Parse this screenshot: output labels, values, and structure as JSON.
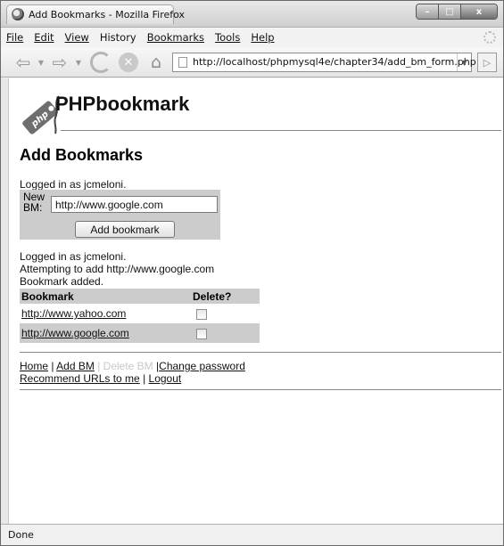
{
  "window": {
    "title": "Add Bookmarks - Mozilla Firefox",
    "minimize": "–",
    "maximize": "□",
    "close": "x"
  },
  "menubar": {
    "file": "File",
    "edit": "Edit",
    "view": "View",
    "history": "History",
    "bookmarks": "Bookmarks",
    "tools": "Tools",
    "help": "Help"
  },
  "navbar": {
    "url": "http://localhost/phpmysql4e/chapter34/add_bm_form.php"
  },
  "page": {
    "brand": "PHPbookmark",
    "logo_badge": "php",
    "title": "Add Bookmarks",
    "logged_in_top": "Logged in as jcmeloni.",
    "form": {
      "label": "New BM:",
      "value": "http://www.google.com",
      "button": "Add bookmark"
    },
    "logged_in_msg": "Logged in as jcmeloni.",
    "attempt_msg": "Attempting to add http://www.google.com",
    "added_msg": "Bookmark added.",
    "table": {
      "headers": [
        "Bookmark",
        "Delete?"
      ],
      "rows": [
        {
          "url": "http://www.yahoo.com",
          "checked": false
        },
        {
          "url": "http://www.google.com",
          "checked": false
        }
      ]
    },
    "links": {
      "home": "Home",
      "add_bm": "Add BM",
      "delete_bm": "Delete BM",
      "change_password": "Change password",
      "recommend": "Recommend URLs to me",
      "logout": "Logout",
      "sep": "|"
    }
  },
  "status": {
    "text": "Done"
  }
}
